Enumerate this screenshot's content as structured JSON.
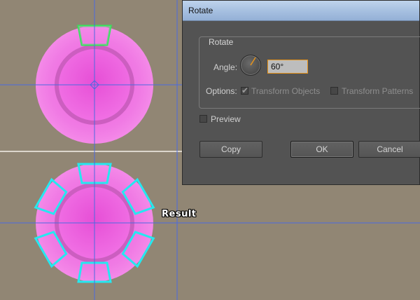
{
  "dialog": {
    "title": "Rotate",
    "group_title": "Rotate",
    "angle_label": "Angle:",
    "angle_value": "60°",
    "options_label": "Options:",
    "transform_objects": {
      "label": "Transform Objects",
      "checked": true,
      "disabled": true
    },
    "transform_patterns": {
      "label": "Transform Patterns",
      "checked": false,
      "disabled": true
    },
    "preview": {
      "label": "Preview",
      "checked": false
    },
    "buttons": {
      "copy": "Copy",
      "ok": "OK",
      "cancel": "Cancel"
    }
  },
  "canvas": {
    "result_label": "Result",
    "colors": {
      "background": "#918674",
      "chip_fill": "#f27ee6",
      "chip_ring": "#cc5ec0",
      "guide": "#4b6ae0",
      "selection_original": "#33e85a",
      "selection_result": "#25e8f0"
    }
  }
}
